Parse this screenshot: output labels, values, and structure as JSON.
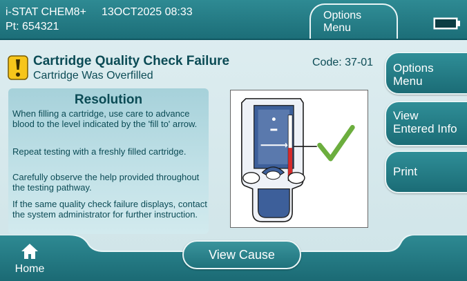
{
  "header": {
    "device": "i-STAT CHEM8+",
    "datetime": "13OCT2025 08:33",
    "patient": "Pt: 654321",
    "options_menu": "Options\nMenu"
  },
  "alert": {
    "icon": "warning-exclamation-icon",
    "title": "Cartridge Quality Check Failure",
    "subtitle": "Cartridge Was Overfilled",
    "code": "Code: 37-01"
  },
  "resolution": {
    "heading": "Resolution",
    "paragraphs": [
      "When filling a cartridge, use care to advance blood to the level indicated by the 'fill to' arrow.",
      "Repeat testing with a freshly filled cartridge.",
      "Carefully observe the help provided throughout the testing pathway.",
      "If the same quality check failure displays, contact the system administrator for further instruction."
    ]
  },
  "side_buttons": {
    "options_menu": "Options\nMenu",
    "view_entered_info": "View\nEntered Info",
    "print": "Print"
  },
  "footer": {
    "home": "Home",
    "view_cause": "View Cause"
  },
  "colors": {
    "teal_dark": "#1c6e78",
    "teal_light": "#cfe4e8",
    "warning_yellow": "#f6c51b",
    "check_green": "#6cae3e",
    "fill_red": "#d62b2b"
  }
}
